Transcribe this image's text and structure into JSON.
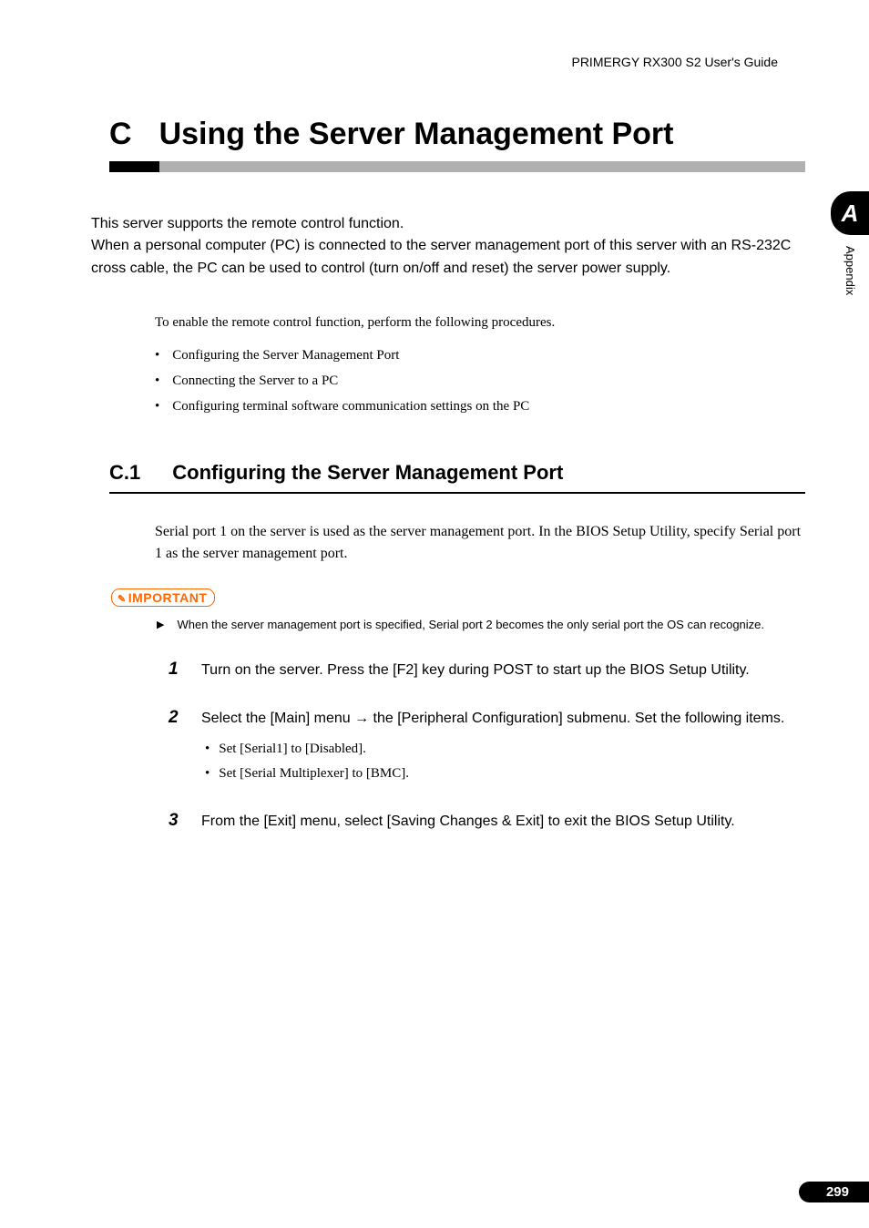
{
  "header": {
    "guide_title": "PRIMERGY RX300 S2 User's Guide"
  },
  "chapter": {
    "letter": "C",
    "title": "Using the Server Management Port"
  },
  "intro": {
    "text": "This server supports the remote control function.\nWhen a personal computer (PC) is connected to the server management port of this server with an RS-232C cross cable, the PC can be used to control (turn on/off and reset) the server power supply."
  },
  "procedure_intro": "To enable the remote control function, perform the following procedures.",
  "bullets": [
    "Configuring the Server Management Port",
    "Connecting the Server to a PC",
    "Configuring terminal software communication settings on the PC"
  ],
  "section": {
    "number": "C.1",
    "title": "Configuring the Server Management Port",
    "body": "Serial port 1 on the server is used as the server management port. In the BIOS Setup Utility, specify Serial port 1 as the server management port."
  },
  "important": {
    "label": "IMPORTANT",
    "text": "When the server management port is specified, Serial port 2 becomes the only serial port the OS can recognize."
  },
  "steps": [
    {
      "num": "1",
      "text": "Turn on the server. Press the [F2] key during POST to start up the BIOS Setup Utility."
    },
    {
      "num": "2",
      "text": "Select the [Main] menu → the [Peripheral Configuration] submenu. Set the following items.",
      "sub": [
        "Set [Serial1] to [Disabled].",
        "Set [Serial Multiplexer] to [BMC]."
      ]
    },
    {
      "num": "3",
      "text": "From the [Exit] menu, select [Saving Changes & Exit] to exit the BIOS Setup Utility."
    }
  ],
  "sidebar": {
    "tab": "A",
    "label": "Appendix"
  },
  "footer": {
    "page": "299"
  }
}
